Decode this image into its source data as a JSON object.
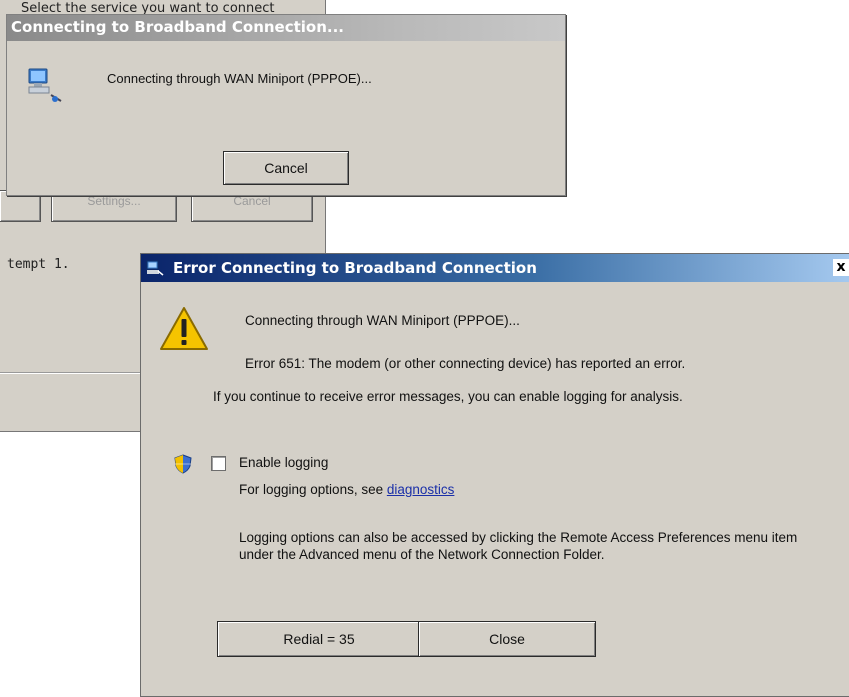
{
  "back_dialog": {
    "top_text": "Select the service you want to connect",
    "button_left_label": "",
    "button_settings_label": "Settings...",
    "button_cancel_label": "Cancel",
    "attempt_text": "tempt 1."
  },
  "connect_dialog": {
    "title": "Connecting to Broadband Connection...",
    "message": "Connecting through WAN Miniport (PPPOE)...",
    "cancel_label": "Cancel",
    "icon": "network-connection-icon"
  },
  "error_dialog": {
    "title": "Error Connecting to Broadband Connection",
    "close_glyph": "x",
    "line1": "Connecting through WAN Miniport (PPPOE)...",
    "line2": "Error 651: The modem (or other connecting device) has reported an error.",
    "info": "If you continue to receive error messages, you can enable logging for analysis.",
    "checkbox_label": "Enable logging",
    "checkbox_checked": false,
    "logging_options_prefix": "For logging options, see ",
    "diagnostics_link": "diagnostics",
    "logging_note": "Logging options can also be accessed by clicking the Remote Access Preferences menu item under the Advanced menu of the Network Connection Folder.",
    "redial_label": "Redial = 35",
    "close_label": "Close",
    "icons": [
      "warning-icon",
      "uac-shield-icon",
      "network-connection-icon"
    ],
    "colors": {
      "title_bar_start": "#0a246a",
      "title_bar_end": "#a6caf0",
      "dialog_bg": "#d4d0c8",
      "link": "#1a2fa8"
    }
  }
}
